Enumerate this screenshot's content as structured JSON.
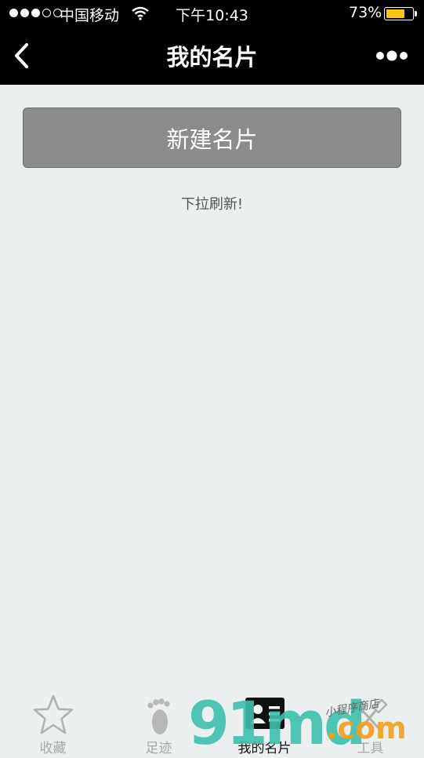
{
  "status_bar": {
    "carrier": "中国移动",
    "time": "下午10:43",
    "battery_percent": "73%",
    "battery_level": 0.73,
    "signal_bars_filled": 3,
    "signal_bars_total": 5
  },
  "nav": {
    "back_icon": "chevron-left-icon",
    "title": "我的名片",
    "more_icon": "more-dots-icon"
  },
  "main": {
    "new_card_label": "新建名片",
    "pull_hint": "下拉刷新!"
  },
  "tabbar": {
    "tabs": [
      {
        "label": "收藏",
        "icon": "star-icon",
        "active": false
      },
      {
        "label": "足迹",
        "icon": "footprint-icon",
        "active": false
      },
      {
        "label": "我的名片",
        "icon": "business-card-icon",
        "active": true
      },
      {
        "label": "工具",
        "icon": "tools-icon",
        "active": false
      }
    ]
  },
  "watermark": {
    "brand": "91md",
    "suffix": ".com",
    "tag": "小程序商店"
  },
  "colors": {
    "nav_background": "#000000",
    "page_background": "#ebeff0",
    "button_background": "#8c8c8c",
    "battery_fill": "#f5c518"
  }
}
